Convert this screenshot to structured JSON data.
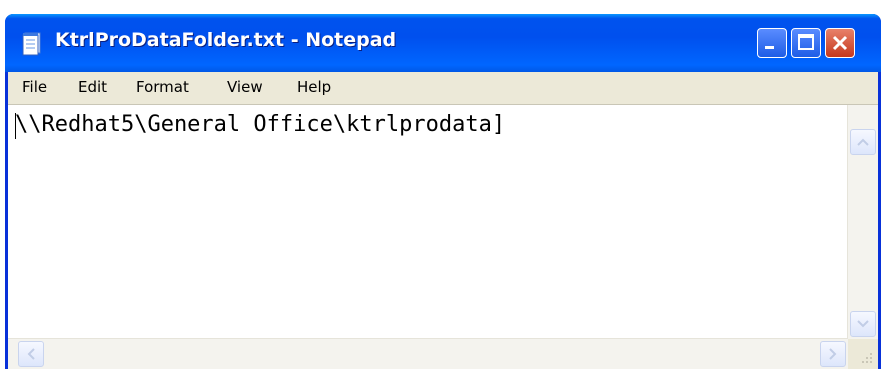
{
  "window": {
    "title": "KtrlProDataFolder.txt - Notepad",
    "controls": {
      "minimize": "minimize",
      "maximize": "maximize",
      "close": "close"
    }
  },
  "menu": {
    "file": "File",
    "edit": "Edit",
    "format": "Format",
    "view": "View",
    "help": "Help"
  },
  "editor": {
    "content": "\\\\Redhat5\\General Office\\ktrlprodata]"
  },
  "icons": {
    "app": "notepad-icon",
    "scroll_up": "arrow-up-icon",
    "scroll_down": "arrow-down-icon",
    "scroll_left": "arrow-left-icon",
    "scroll_right": "arrow-right-icon",
    "grip": "resize-grip-icon"
  },
  "colors": {
    "titlebar": "#0054e3",
    "close_button": "#d4452a",
    "menu_background": "#ece9d8"
  }
}
